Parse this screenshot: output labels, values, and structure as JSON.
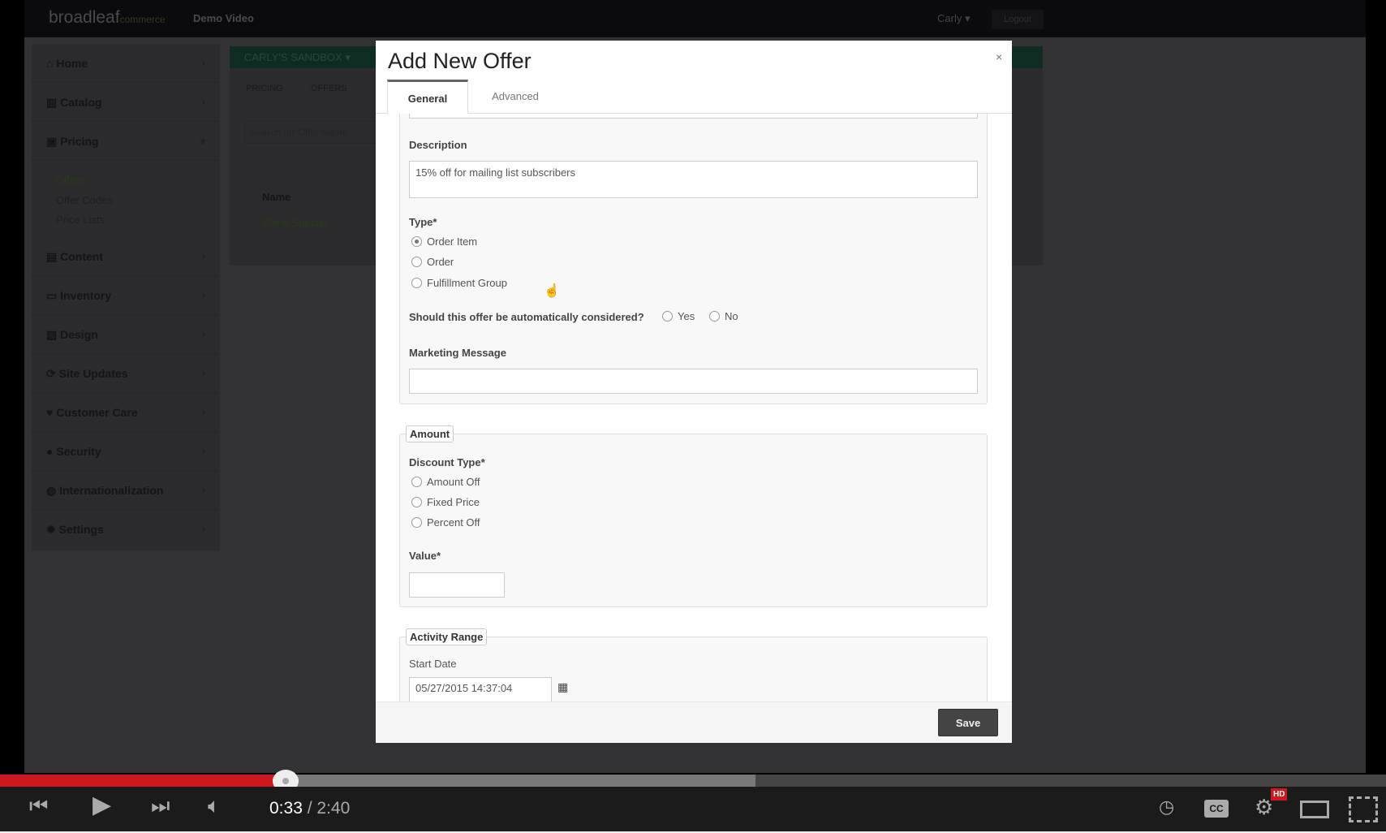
{
  "nav": {
    "logo": "broadleaf",
    "logo_sub": "commerce",
    "title": "Demo Video",
    "user": "Carly",
    "logout": "Logout"
  },
  "sidebar": {
    "items": [
      {
        "label": "Home",
        "icon": "home-icon"
      },
      {
        "label": "Catalog",
        "icon": "barcode-icon"
      },
      {
        "label": "Pricing",
        "icon": "money-icon"
      },
      {
        "label": "Content",
        "icon": "file-icon"
      },
      {
        "label": "Inventory",
        "icon": "inbox-icon"
      },
      {
        "label": "Design",
        "icon": "picture-icon"
      },
      {
        "label": "Site Updates",
        "icon": "refresh-icon"
      },
      {
        "label": "Customer Care",
        "icon": "heart-icon"
      },
      {
        "label": "Security",
        "icon": "user-icon"
      },
      {
        "label": "Internationalization",
        "icon": "globe-icon"
      },
      {
        "label": "Settings",
        "icon": "gear-icon"
      }
    ],
    "pricing_sub": [
      "Offers",
      "Offer Codes",
      "Price Lists"
    ]
  },
  "main": {
    "sandbox": "CARLY'S SANDBOX",
    "breadcrumb": [
      "PRICING",
      "OFFERS"
    ],
    "search_placeholder": "Search for Offer Name",
    "column": "Name",
    "row": "Shirts Special"
  },
  "modal": {
    "title": "Add New Offer",
    "close": "×",
    "tabs": [
      "General",
      "Advanced"
    ],
    "description_label": "Description",
    "description_value": "15% off for mailing list subscribers",
    "type_label": "Type*",
    "type_options": [
      "Order Item",
      "Order",
      "Fulfillment Group"
    ],
    "auto_label": "Should this offer be automatically considered?",
    "auto_yes": "Yes",
    "auto_no": "No",
    "marketing_label": "Marketing Message",
    "marketing_value": "",
    "amount_legend": "Amount",
    "discount_label": "Discount Type*",
    "discount_options": [
      "Amount Off",
      "Fixed Price",
      "Percent Off"
    ],
    "value_label": "Value*",
    "value_value": "",
    "activity_legend": "Activity Range",
    "start_label": "Start Date",
    "start_value": "05/27/2015 14:37:04",
    "save": "Save"
  },
  "player": {
    "current": "0:33",
    "duration": "2:40",
    "played_fraction": 0.206,
    "buffered_fraction": 0.545,
    "hd": "HD"
  }
}
